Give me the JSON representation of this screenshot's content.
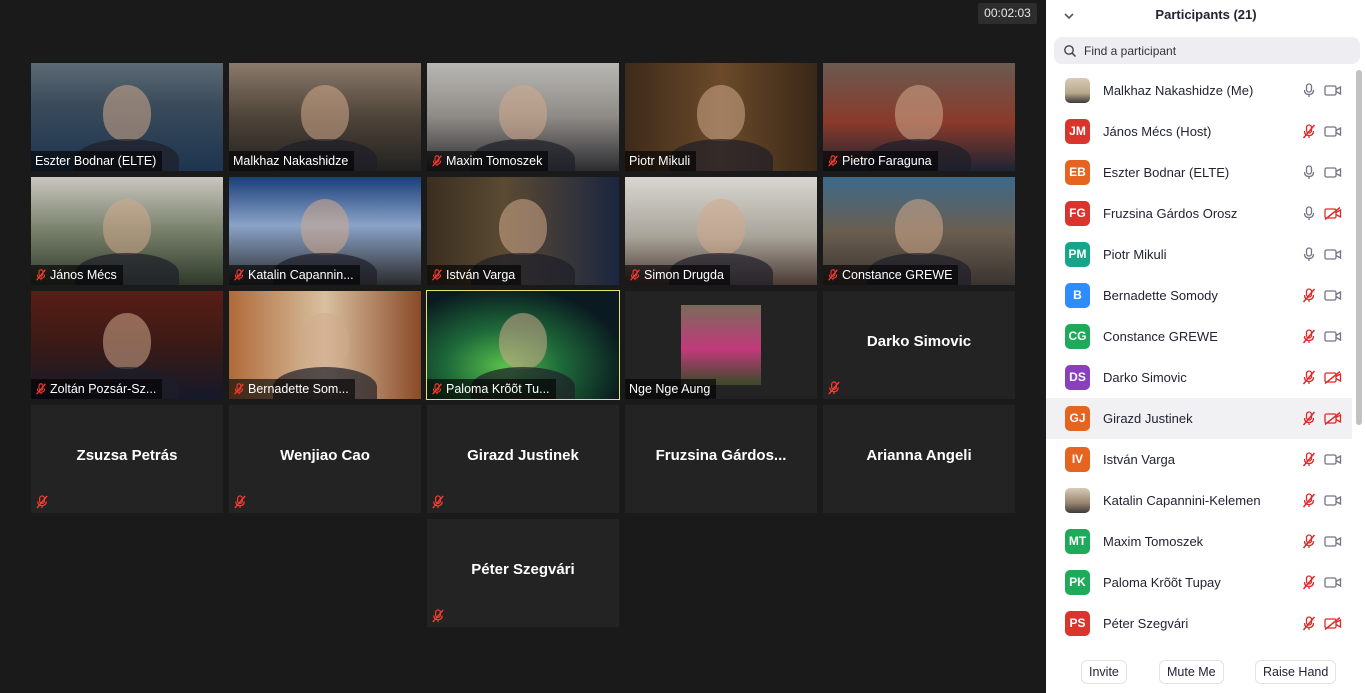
{
  "meeting": {
    "timer": "00:02:03"
  },
  "gallery": {
    "tiles": [
      {
        "name": "Eszter Bodnar (ELTE)",
        "muted": false,
        "video": true
      },
      {
        "name": "Malkhaz Nakashidze",
        "muted": false,
        "video": true
      },
      {
        "name": "Maxim Tomoszek",
        "muted": true,
        "video": true
      },
      {
        "name": "Piotr Mikuli",
        "muted": false,
        "video": true
      },
      {
        "name": "Pietro Faraguna",
        "muted": true,
        "video": true
      },
      {
        "name": "János Mécs",
        "muted": true,
        "video": true
      },
      {
        "name": "Katalin Capannin...",
        "muted": true,
        "video": true
      },
      {
        "name": "István Varga",
        "muted": true,
        "video": true
      },
      {
        "name": "Simon Drugda",
        "muted": true,
        "video": true
      },
      {
        "name": "Constance GREWE",
        "muted": true,
        "video": true
      },
      {
        "name": "Zoltán Pozsár-Sz...",
        "muted": true,
        "video": true
      },
      {
        "name": "Bernadette Som...",
        "muted": true,
        "video": true
      },
      {
        "name": "Paloma Krõõt Tu...",
        "muted": true,
        "video": true,
        "active": true
      },
      {
        "name": "Nge Nge Aung",
        "muted": false,
        "video": true
      },
      {
        "name": "Darko Simovic",
        "muted": true,
        "video": false
      },
      {
        "name": "Zsuzsa Petrás",
        "muted": true,
        "video": false
      },
      {
        "name": "Wenjiao Cao",
        "muted": true,
        "video": false
      },
      {
        "name": "Girazd Justinek",
        "muted": true,
        "video": false
      },
      {
        "name": "Fruzsina  Gárdos...",
        "muted": false,
        "video": false
      },
      {
        "name": "Arianna Angeli",
        "muted": false,
        "video": false
      },
      {
        "name": "Péter Szegvári",
        "muted": true,
        "video": false
      }
    ]
  },
  "participants_panel": {
    "title": "Participants (21)",
    "search_placeholder": "Find a participant",
    "participants": [
      {
        "name": "Malkhaz Nakashidze (Me)",
        "initials": "",
        "photo": true,
        "color": "#b8a98a",
        "mic": "on",
        "cam": "on"
      },
      {
        "name": "János Mécs (Host)",
        "initials": "JM",
        "color": "#d9352d",
        "mic": "off",
        "cam": "on"
      },
      {
        "name": "Eszter Bodnar (ELTE)",
        "initials": "EB",
        "color": "#e5641f",
        "mic": "on",
        "cam": "on"
      },
      {
        "name": "Fruzsina Gárdos Orosz",
        "initials": "FG",
        "color": "#d9352d",
        "mic": "on",
        "cam": "off"
      },
      {
        "name": "Piotr Mikuli",
        "initials": "PM",
        "color": "#17a58a",
        "mic": "on",
        "cam": "on"
      },
      {
        "name": "Bernadette Somody",
        "initials": "B",
        "color": "#2d8cff",
        "mic": "off",
        "cam": "on"
      },
      {
        "name": "Constance GREWE",
        "initials": "CG",
        "color": "#1faa59",
        "mic": "off",
        "cam": "on"
      },
      {
        "name": "Darko Simovic",
        "initials": "DS",
        "color": "#8a3fbf",
        "mic": "off",
        "cam": "off"
      },
      {
        "name": "Girazd Justinek",
        "initials": "GJ",
        "color": "#e5641f",
        "mic": "off",
        "cam": "off",
        "highlight": true
      },
      {
        "name": "István Varga",
        "initials": "IV",
        "color": "#e5641f",
        "mic": "off",
        "cam": "on"
      },
      {
        "name": "Katalin Capannini-Kelemen",
        "initials": "",
        "photo": true,
        "color": "#9a8570",
        "mic": "off",
        "cam": "on"
      },
      {
        "name": "Maxim Tomoszek",
        "initials": "MT",
        "color": "#1faa59",
        "mic": "off",
        "cam": "on"
      },
      {
        "name": "Paloma Krõõt Tupay",
        "initials": "PK",
        "color": "#1faa59",
        "mic": "off",
        "cam": "on"
      },
      {
        "name": "Péter Szegvári",
        "initials": "PS",
        "color": "#d9352d",
        "mic": "off",
        "cam": "off"
      }
    ],
    "buttons": {
      "invite": "Invite",
      "mute_me": "Mute Me",
      "raise_hand": "Raise Hand"
    }
  }
}
